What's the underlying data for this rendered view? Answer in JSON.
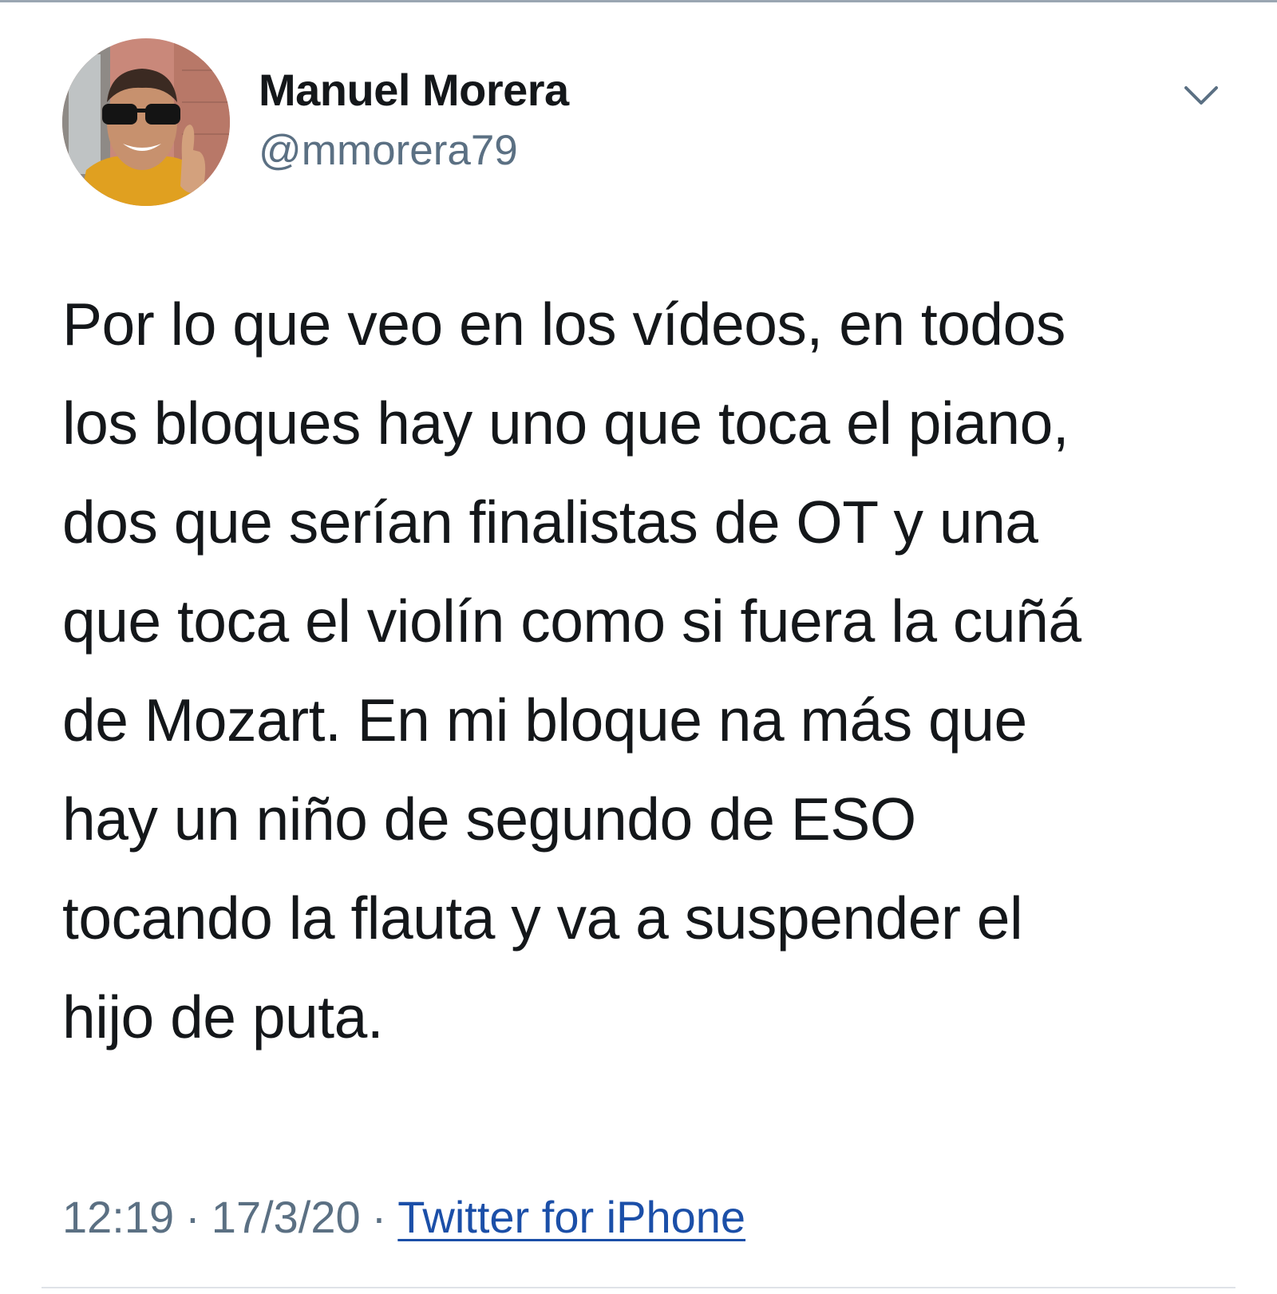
{
  "tweet": {
    "author": {
      "display_name": "Manuel Morera",
      "handle": "@mmorera79"
    },
    "menu_icon": "chevron-down-icon",
    "text_lines": [
      "Por lo que veo en los vídeos, en todos",
      "los bloques hay uno que toca el piano,",
      "dos que serían finalistas de OT y una",
      "que toca el violín como si fuera la cuñá",
      "de Mozart. En mi bloque na más que",
      "hay un niño de segundo de ESO",
      "tocando la flauta y va a suspender el",
      "hijo de puta."
    ],
    "meta": {
      "time": "12:19",
      "separator": "·",
      "date": "17/3/20",
      "source": "Twitter for iPhone"
    }
  },
  "colors": {
    "text": "#14171a",
    "secondary_text": "#5b7083",
    "link": "#1b4fa8",
    "background": "#ffffff"
  }
}
